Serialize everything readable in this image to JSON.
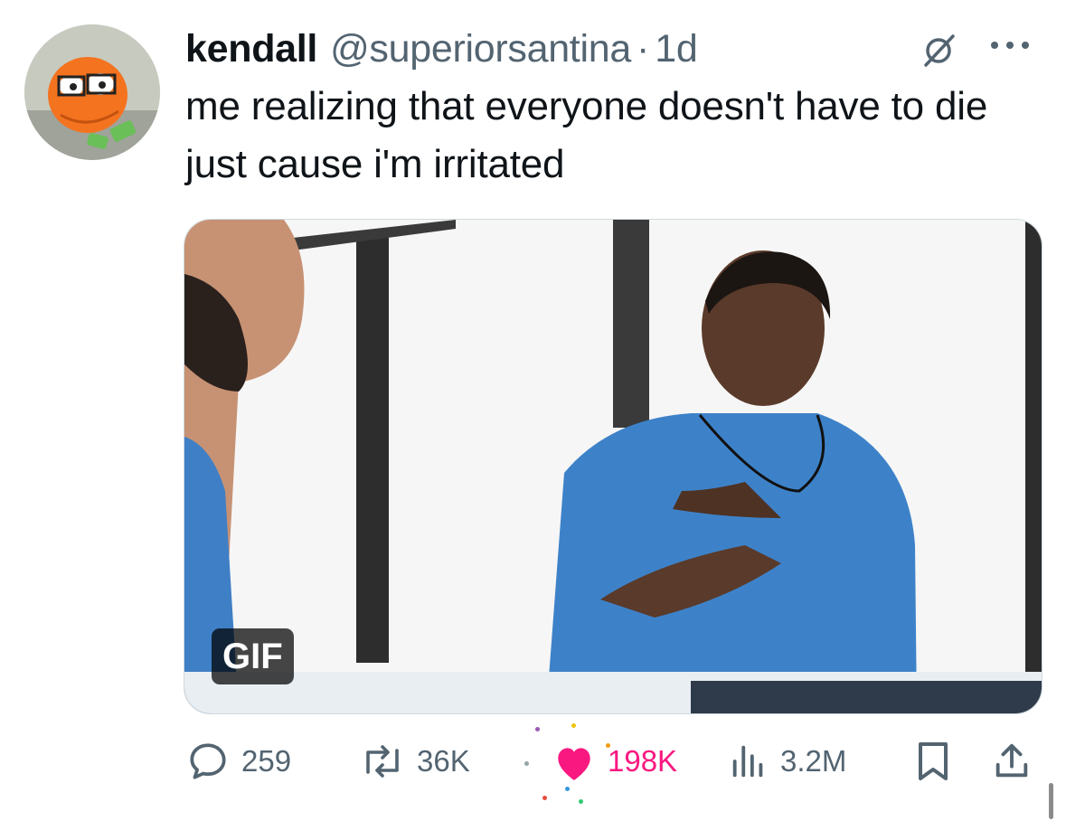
{
  "tweet": {
    "display_name": "kendall",
    "handle": "@superiorsantina",
    "separator": "·",
    "time": "1d",
    "text": "me realizing that everyone doesn't have to die just cause i'm irritated",
    "media": {
      "type": "gif",
      "badge": "GIF"
    }
  },
  "metrics": {
    "replies": "259",
    "reposts": "36K",
    "likes": "198K",
    "views": "3.2M"
  },
  "icons": {
    "grok": "grok-icon",
    "more": "more-dots-icon",
    "reply": "reply-bubble-icon",
    "repost": "repost-arrows-icon",
    "like": "heart-filled-icon",
    "views": "bar-chart-icon",
    "bookmark": "bookmark-icon",
    "share": "share-upload-icon"
  },
  "colors": {
    "text": "#0f1419",
    "secondary": "#536471",
    "like_active": "#f91880"
  }
}
